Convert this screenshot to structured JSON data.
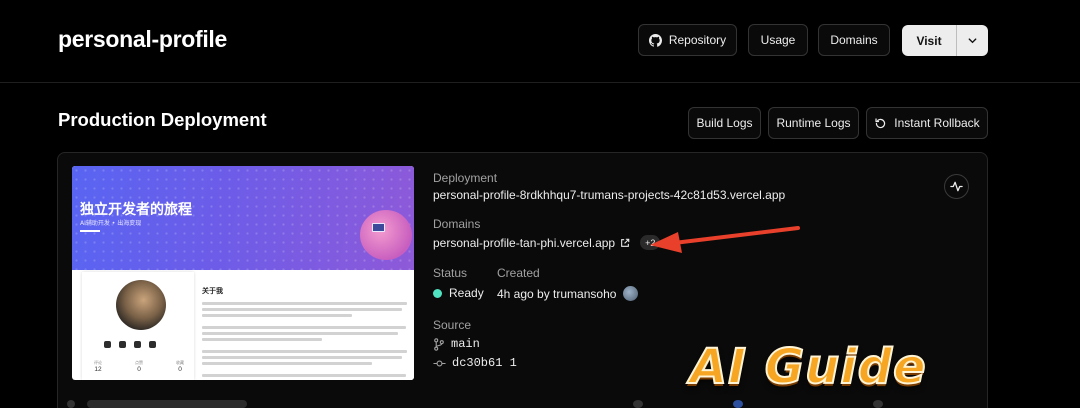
{
  "header": {
    "project_name": "personal-profile",
    "buttons": {
      "repository": "Repository",
      "usage": "Usage",
      "domains": "Domains",
      "visit": "Visit"
    }
  },
  "production": {
    "title": "Production Deployment",
    "buttons": {
      "build_logs": "Build Logs",
      "runtime_logs": "Runtime Logs",
      "instant_rollback": "Instant Rollback"
    },
    "preview": {
      "hero_title": "独立开发者的旅程",
      "hero_subtitle": "AI辅助开发 • 出海变现",
      "about_title": "关于我",
      "stats": [
        {
          "label": "评论",
          "value": "12"
        },
        {
          "label": "点赞",
          "value": "0"
        },
        {
          "label": "收藏",
          "value": "0"
        }
      ]
    },
    "deployment": {
      "label": "Deployment",
      "url": "personal-profile-8rdkhhqu7-trumans-projects-42c81d53.vercel.app"
    },
    "domains": {
      "label": "Domains",
      "url": "personal-profile-tan-phi.vercel.app",
      "more": "+2"
    },
    "status": {
      "label": "Status",
      "value": "Ready",
      "color": "#50e3c2"
    },
    "created": {
      "label": "Created",
      "value": "4h ago by trumansoho"
    },
    "source": {
      "label": "Source",
      "branch": "main",
      "commit": "dc30b61 1"
    }
  },
  "overlay": {
    "watermark": "AI Guide",
    "arrow_color": "#e8402a"
  }
}
